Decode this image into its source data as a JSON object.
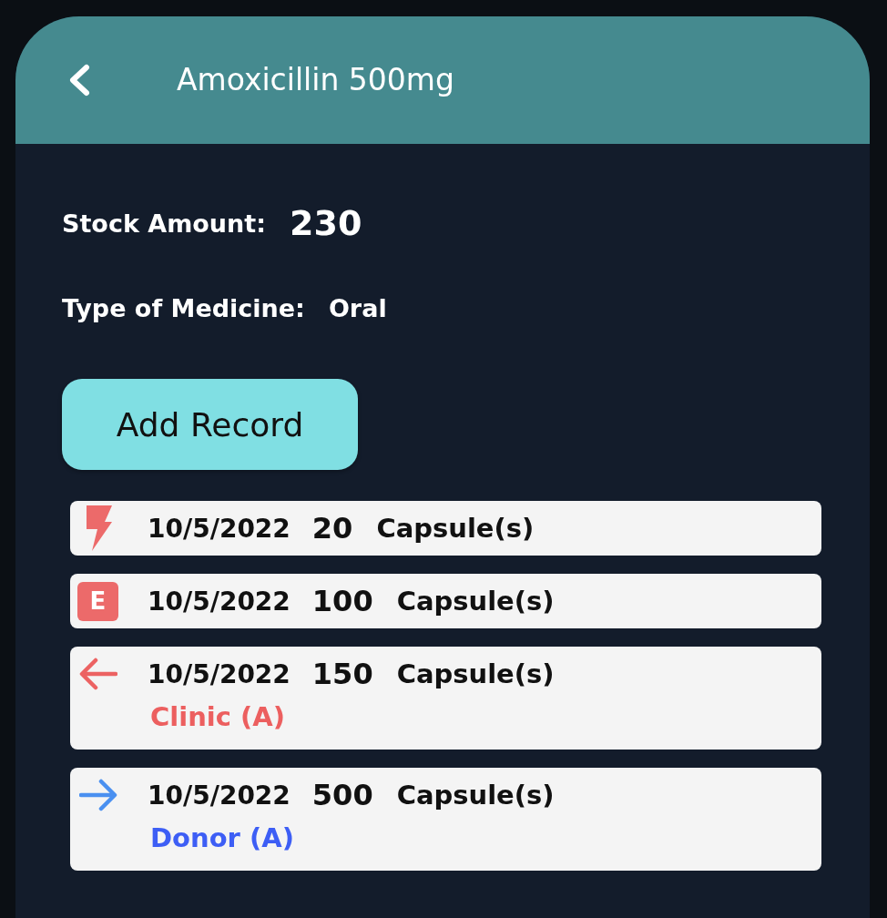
{
  "header": {
    "title": "Amoxicillin 500mg"
  },
  "details": [
    {
      "kind": "emphasis",
      "label": "Stock Amount:",
      "value": "230"
    },
    {
      "kind": "plain",
      "label": "Type of Medicine:",
      "value": "Oral"
    }
  ],
  "add_button": {
    "label": "Add Record"
  },
  "records": [
    {
      "kind": "bolt",
      "color": "#ec6a6a",
      "date": "10/5/2022",
      "amount": "20",
      "unit": "Capsule(s)"
    },
    {
      "kind": "letter",
      "badge": "E",
      "color": "#ec6a6a",
      "date": "10/5/2022",
      "amount": "100",
      "unit": "Capsule(s)"
    },
    {
      "kind": "left",
      "color": "#ec6262",
      "date": "10/5/2022",
      "amount": "150",
      "unit": "Capsule(s)",
      "source": {
        "label": "Clinic (A)",
        "color": "#ec5f5f"
      }
    },
    {
      "kind": "right",
      "color": "#4a90f0",
      "date": "10/5/2022",
      "amount": "500",
      "unit": "Capsule(s)",
      "source": {
        "label": "Donor (A)",
        "color": "#3d5ef5"
      }
    }
  ]
}
